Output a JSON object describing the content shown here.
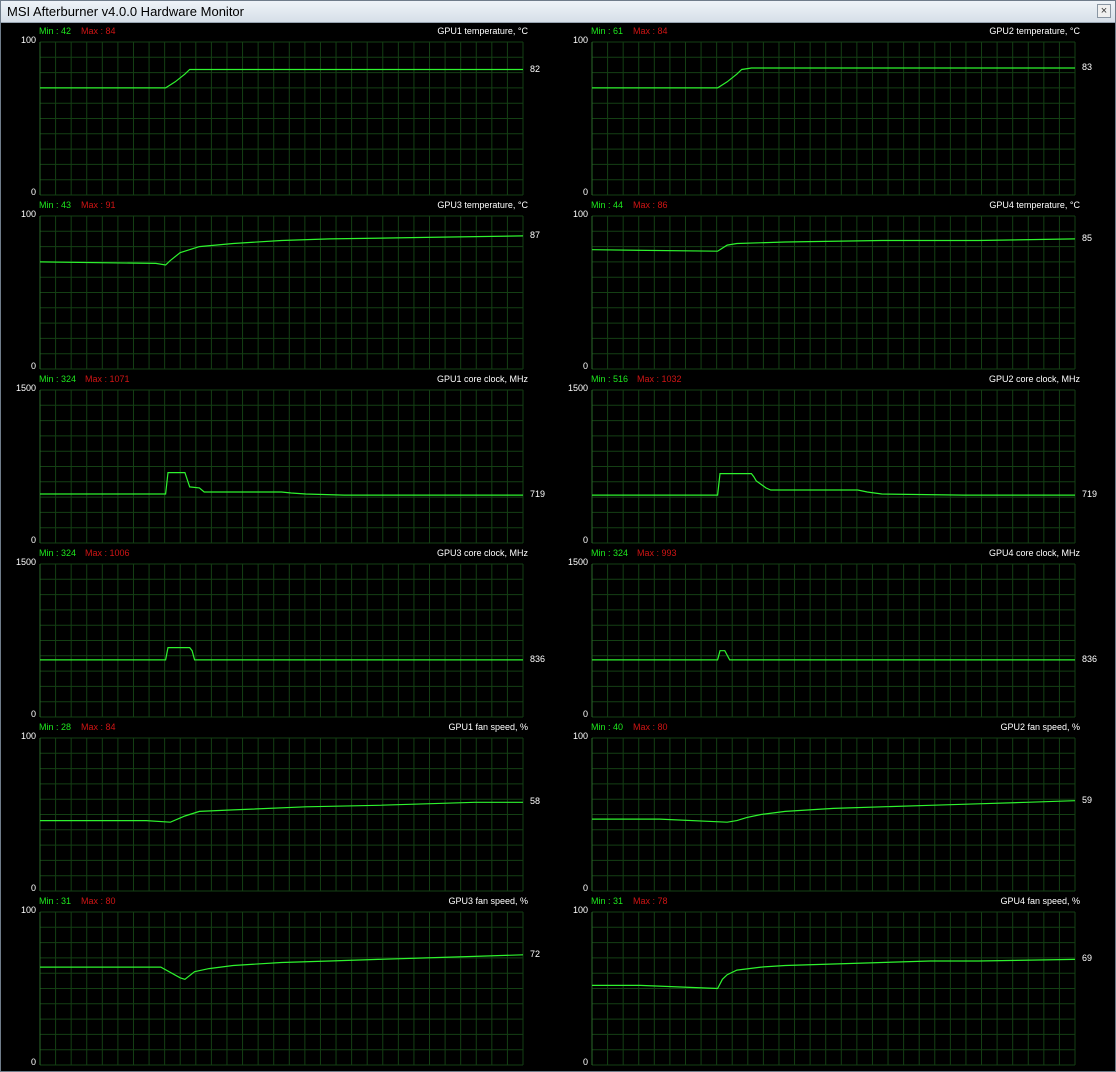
{
  "window": {
    "title": "MSI Afterburner v4.0.0 Hardware Monitor",
    "close_glyph": "×"
  },
  "colors": {
    "line": "#2ef22e",
    "grid": "#143f14",
    "min": "#1ee81e",
    "max": "#d01515",
    "background": "#000000"
  },
  "graphs": [
    {
      "title": "GPU1 temperature, °C",
      "min_label": "Min : 42",
      "max_label": "Max : 84",
      "y_top": "100",
      "y_bottom": "0",
      "current": "82"
    },
    {
      "title": "GPU2 temperature, °C",
      "min_label": "Min : 61",
      "max_label": "Max : 84",
      "y_top": "100",
      "y_bottom": "0",
      "current": "83"
    },
    {
      "title": "GPU3 temperature, °C",
      "min_label": "Min : 43",
      "max_label": "Max : 91",
      "y_top": "100",
      "y_bottom": "0",
      "current": "87"
    },
    {
      "title": "GPU4 temperature, °C",
      "min_label": "Min : 44",
      "max_label": "Max : 86",
      "y_top": "100",
      "y_bottom": "0",
      "current": "85"
    },
    {
      "title": "GPU1 core clock, MHz",
      "min_label": "Min : 324",
      "max_label": "Max : 1071",
      "y_top": "1500",
      "y_bottom": "0",
      "current": "719"
    },
    {
      "title": "GPU2 core clock, MHz",
      "min_label": "Min : 516",
      "max_label": "Max : 1032",
      "y_top": "1500",
      "y_bottom": "0",
      "current": "719"
    },
    {
      "title": "GPU3 core clock, MHz",
      "min_label": "Min : 324",
      "max_label": "Max : 1006",
      "y_top": "1500",
      "y_bottom": "0",
      "current": "836"
    },
    {
      "title": "GPU4 core clock, MHz",
      "min_label": "Min : 324",
      "max_label": "Max : 993",
      "y_top": "1500",
      "y_bottom": "0",
      "current": "836"
    },
    {
      "title": "GPU1 fan speed, %",
      "min_label": "Min : 28",
      "max_label": "Max : 84",
      "y_top": "100",
      "y_bottom": "0",
      "current": "58"
    },
    {
      "title": "GPU2 fan speed, %",
      "min_label": "Min : 40",
      "max_label": "Max : 80",
      "y_top": "100",
      "y_bottom": "0",
      "current": "59"
    },
    {
      "title": "GPU3 fan speed, %",
      "min_label": "Min : 31",
      "max_label": "Max : 80",
      "y_top": "100",
      "y_bottom": "0",
      "current": "72"
    },
    {
      "title": "GPU4 fan speed, %",
      "min_label": "Min : 31",
      "max_label": "Max : 78",
      "y_top": "100",
      "y_bottom": "0",
      "current": "69"
    }
  ],
  "chart_data": [
    {
      "type": "line",
      "series": [
        {
          "x": [
            0,
            0.26,
            0.28,
            0.3,
            0.31,
            0.33,
            1
          ],
          "values": [
            70,
            70,
            74,
            79,
            82,
            82,
            82
          ]
        }
      ],
      "ylim": [
        0,
        100
      ]
    },
    {
      "type": "line",
      "series": [
        {
          "x": [
            0,
            0.26,
            0.28,
            0.3,
            0.31,
            0.33,
            1
          ],
          "values": [
            70,
            70,
            74,
            79,
            82,
            83,
            83
          ]
        }
      ],
      "ylim": [
        0,
        100
      ]
    },
    {
      "type": "line",
      "series": [
        {
          "x": [
            0,
            0.24,
            0.26,
            0.27,
            0.29,
            0.33,
            0.4,
            0.5,
            0.6,
            0.8,
            1
          ],
          "values": [
            70,
            69,
            68,
            71,
            76,
            80,
            82,
            84,
            85,
            86,
            87
          ]
        }
      ],
      "ylim": [
        0,
        100
      ]
    },
    {
      "type": "line",
      "series": [
        {
          "x": [
            0,
            0.26,
            0.27,
            0.28,
            0.3,
            0.4,
            0.6,
            0.8,
            1
          ],
          "values": [
            78,
            77,
            79,
            81,
            82,
            83,
            84,
            84,
            85
          ]
        }
      ],
      "ylim": [
        0,
        100
      ]
    },
    {
      "type": "line",
      "series": [
        {
          "x": [
            0,
            0.26,
            0.265,
            0.3,
            0.31,
            0.33,
            0.34,
            0.5,
            0.52,
            0.55,
            0.63,
            1
          ],
          "values": [
            480,
            480,
            690,
            690,
            550,
            540,
            500,
            500,
            490,
            480,
            470,
            470
          ]
        }
      ],
      "ylim": [
        0,
        1500
      ]
    },
    {
      "type": "line",
      "series": [
        {
          "x": [
            0,
            0.26,
            0.265,
            0.33,
            0.335,
            0.34,
            0.36,
            0.37,
            0.55,
            0.57,
            0.6,
            0.77,
            1
          ],
          "values": [
            470,
            470,
            680,
            680,
            650,
            610,
            540,
            520,
            520,
            500,
            480,
            470,
            470
          ]
        }
      ],
      "ylim": [
        0,
        1500
      ]
    },
    {
      "type": "line",
      "series": [
        {
          "x": [
            0,
            0.26,
            0.265,
            0.31,
            0.315,
            0.32,
            1
          ],
          "values": [
            560,
            560,
            680,
            680,
            650,
            560,
            560
          ]
        }
      ],
      "ylim": [
        0,
        1500
      ]
    },
    {
      "type": "line",
      "series": [
        {
          "x": [
            0,
            0.26,
            0.265,
            0.275,
            0.285,
            1
          ],
          "values": [
            560,
            560,
            650,
            650,
            560,
            560
          ]
        }
      ],
      "ylim": [
        0,
        1500
      ]
    },
    {
      "type": "line",
      "series": [
        {
          "x": [
            0,
            0.22,
            0.27,
            0.3,
            0.33,
            0.4,
            0.55,
            0.7,
            0.8,
            0.9,
            1
          ],
          "values": [
            46,
            46,
            45,
            49,
            52,
            53,
            55,
            56,
            57,
            58,
            58
          ]
        }
      ],
      "ylim": [
        0,
        100
      ]
    },
    {
      "type": "line",
      "series": [
        {
          "x": [
            0,
            0.14,
            0.28,
            0.3,
            0.32,
            0.35,
            0.4,
            0.5,
            0.7,
            0.8,
            0.9,
            1
          ],
          "values": [
            47,
            47,
            45,
            46,
            48,
            50,
            52,
            54,
            56,
            57,
            58,
            59
          ]
        }
      ],
      "ylim": [
        0,
        100
      ]
    },
    {
      "type": "line",
      "series": [
        {
          "x": [
            0,
            0.25,
            0.29,
            0.3,
            0.32,
            0.35,
            0.4,
            0.5,
            0.6,
            0.7,
            0.8,
            0.9,
            1
          ],
          "values": [
            64,
            64,
            57,
            56,
            61,
            63,
            65,
            67,
            68,
            69,
            70,
            71,
            72
          ]
        }
      ],
      "ylim": [
        0,
        100
      ]
    },
    {
      "type": "line",
      "series": [
        {
          "x": [
            0,
            0.1,
            0.26,
            0.27,
            0.28,
            0.3,
            0.35,
            0.4,
            0.5,
            0.6,
            0.7,
            0.8,
            1
          ],
          "values": [
            52,
            52,
            50,
            56,
            59,
            62,
            64,
            65,
            66,
            67,
            68,
            68,
            69
          ]
        }
      ],
      "ylim": [
        0,
        100
      ]
    }
  ]
}
